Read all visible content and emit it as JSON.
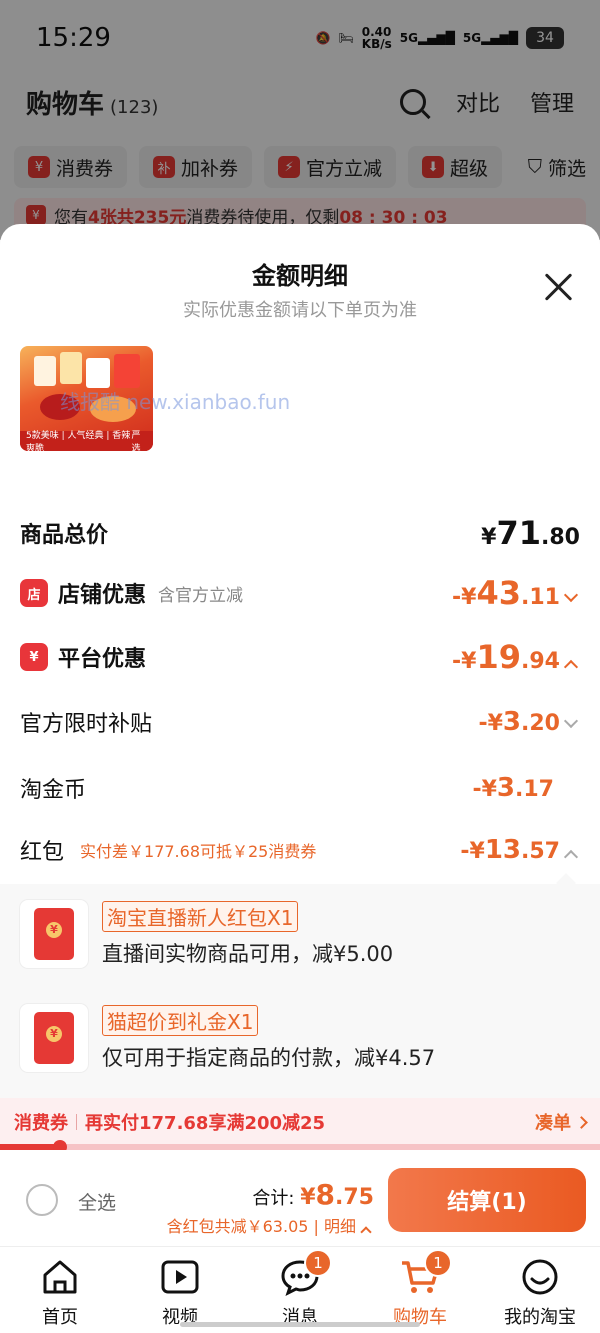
{
  "status_bar": {
    "time": "15:29",
    "speed": "0.40",
    "speed_unit": "KB/s",
    "net1": "5G",
    "net2": "5G",
    "battery": "34"
  },
  "cart_header": {
    "title": "购物车",
    "count": "(123)",
    "compare": "对比",
    "manage": "管理"
  },
  "chips": [
    {
      "icon": "¥",
      "label": "消费券"
    },
    {
      "icon": "补",
      "label": "加补券"
    },
    {
      "icon": "⚡",
      "label": "官方立减"
    },
    {
      "icon": "⬇",
      "label": "超级"
    }
  ],
  "filter_label": "筛选",
  "notice": {
    "pre": "您有",
    "highlight": "4张共235元",
    "mid": "消费券待使用，仅剩",
    "countdown": "08 : 30 : 03"
  },
  "sheet": {
    "title": "金额明细",
    "subtitle": "实际优惠金额请以下单页为准",
    "product_caption_left": "5款美味 | 人气经典 | 香辣爽脆",
    "product_caption_right": "严选",
    "watermark": "线报酷 new.xianbao.fun",
    "total": {
      "label": "商品总价",
      "currency": "¥",
      "int": "71",
      "dec": ".80"
    },
    "store_discount": {
      "icon": "店",
      "label": "店铺优惠",
      "sub": "含官方立减",
      "prefix": "-¥",
      "int": "43",
      "dec": ".11"
    },
    "platform_discount": {
      "icon": "¥",
      "label": "平台优惠",
      "prefix": "-¥",
      "int": "19",
      "dec": ".94"
    },
    "subsidy": {
      "label": "官方限时补贴",
      "prefix": "-¥",
      "int": "3",
      "dec": ".20"
    },
    "coins": {
      "label": "淘金币",
      "prefix": "-¥",
      "int": "3",
      "dec": ".17"
    },
    "red_packet": {
      "label": "红包",
      "note": "实付差￥177.68可抵￥25消费券",
      "prefix": "-¥",
      "int": "13",
      "dec": ".57"
    },
    "red_packet_items": [
      {
        "tag": "淘宝直播新人红包X1",
        "desc": "直播间实物商品可用，减¥5.00"
      },
      {
        "tag": "猫超价到礼金X1",
        "desc": "仅可用于指定商品的付款，减¥4.57"
      }
    ],
    "coupon_bar": {
      "label": "消费券",
      "text": "再实付177.68享满200减25",
      "action": "凑单"
    },
    "coupon_progress": 0.1
  },
  "checkout": {
    "select_all": "全选",
    "sum_label": "合计:",
    "sum_currency": "¥",
    "sum_int": "8",
    "sum_dec": ".75",
    "savings": "含红包共减￥63.05 | 明细",
    "pay_button": "结算(1)"
  },
  "tabbar": [
    {
      "label": "首页",
      "icon": "home-icon"
    },
    {
      "label": "视频",
      "icon": "video-icon"
    },
    {
      "label": "消息",
      "icon": "message-icon",
      "badge": "1"
    },
    {
      "label": "购物车",
      "icon": "cart-icon",
      "badge": "1",
      "active": true
    },
    {
      "label": "我的淘宝",
      "icon": "profile-icon"
    }
  ],
  "colors": {
    "accent": "#e8662a",
    "red": "#e53935"
  }
}
